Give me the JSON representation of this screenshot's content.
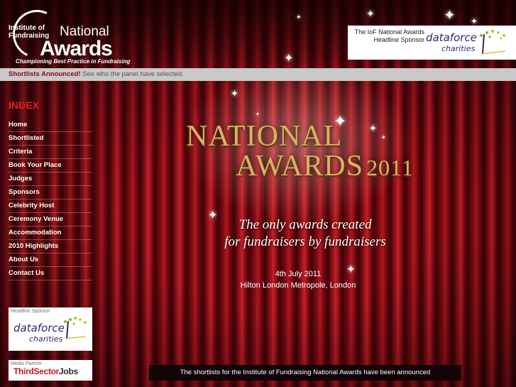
{
  "logo": {
    "line1": "Institute of",
    "line2": "Fundraising",
    "national": "National",
    "awards": "Awards",
    "tagline": "Championing Best Practice in Fundraising"
  },
  "headline_sponsor_box": {
    "text_line1": "The IoF National Awards",
    "text_line2": "Headline Sponsor",
    "brand_name": "dataforce",
    "brand_sub": "charities"
  },
  "announcement": {
    "bold": "Shortlists Announced!",
    "rest": "See who the panel have selected."
  },
  "sidebar": {
    "index_title": "INDEX",
    "items": [
      {
        "label": "Home"
      },
      {
        "label": "Shortlisted"
      },
      {
        "label": "Criteria"
      },
      {
        "label": "Book Your Place"
      },
      {
        "label": "Judges"
      },
      {
        "label": "Sponsors"
      },
      {
        "label": "Celebrity Host"
      },
      {
        "label": "Ceremony Venue"
      },
      {
        "label": "Accommodation"
      },
      {
        "label": "2010 Highlights"
      },
      {
        "label": "About Us"
      },
      {
        "label": "Contact Us"
      }
    ],
    "headline_sponsor_label": "Headline Sponsor",
    "sponsor_brand": "dataforce",
    "sponsor_sub": "charities",
    "media_partner_label": "Media Partner",
    "media_partner_brand_a": "ThirdSector",
    "media_partner_brand_b": "Jobs"
  },
  "hero": {
    "title_line1": "NATIONAL",
    "title_line2": "AWARDS",
    "title_year": "2011",
    "tagline_line1": "The only awards created",
    "tagline_line2": "for fundraisers by fundraisers",
    "date": "4th July 2011",
    "venue": "Hilton London Metropole, London"
  },
  "banner": {
    "text": "The shortlists for the Institute of Fundraising National Awards have been announced"
  },
  "colors": {
    "curtain_red": "#b01820",
    "index_red": "#e61e23",
    "gold": "#d8b262",
    "announce_bar": "#c9c9c9"
  }
}
